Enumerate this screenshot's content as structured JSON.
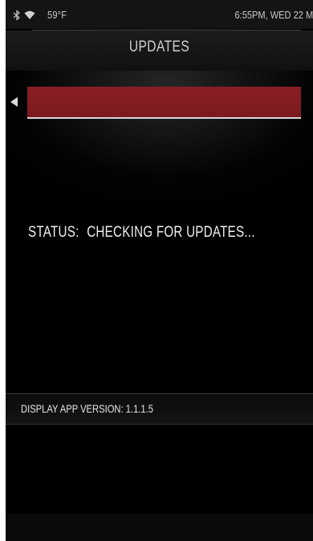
{
  "status_bar": {
    "bluetooth_icon": "bluetooth-icon",
    "wifi_icon": "wifi-icon",
    "temperature": "59°F",
    "datetime": "6:55PM, WED 22 MA"
  },
  "header": {
    "title": "UPDATES",
    "back_icon": "back-arrow-icon"
  },
  "progress": {
    "fill_fraction": 1.0,
    "color": "#8a1e23"
  },
  "status": {
    "label": "STATUS:",
    "value": "CHECKING FOR UPDATES..."
  },
  "version": {
    "text": "DISPLAY APP VERSION: 1.1.1.5"
  },
  "colors": {
    "background": "#000000",
    "accent": "#8a1e23",
    "text": "#e8e8e8"
  }
}
